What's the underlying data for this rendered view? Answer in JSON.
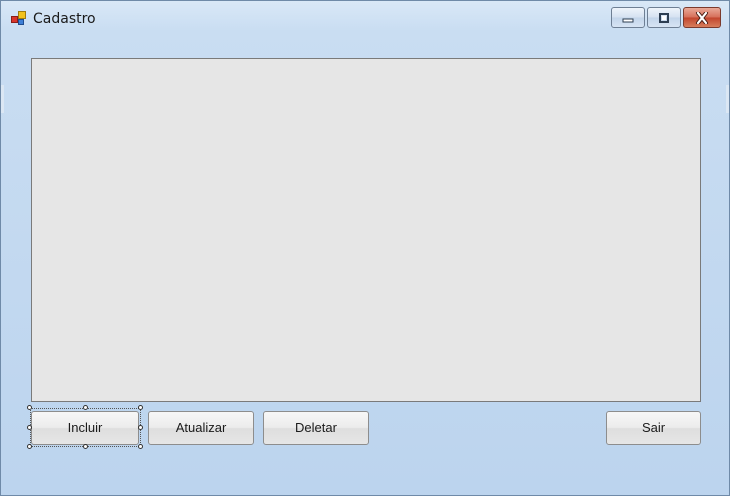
{
  "window": {
    "title": "Cadastro",
    "controls": {
      "minimize_icon": "minimize-icon",
      "maximize_icon": "restore-icon",
      "close_icon": "close-icon"
    }
  },
  "buttons": {
    "incluir": "Incluir",
    "atualizar": "Atualizar",
    "deletar": "Deletar",
    "sair": "Sair"
  },
  "colors": {
    "frame": "#bcd4ee",
    "grid_background": "#e6e6e6",
    "close_button": "#c2452d"
  }
}
